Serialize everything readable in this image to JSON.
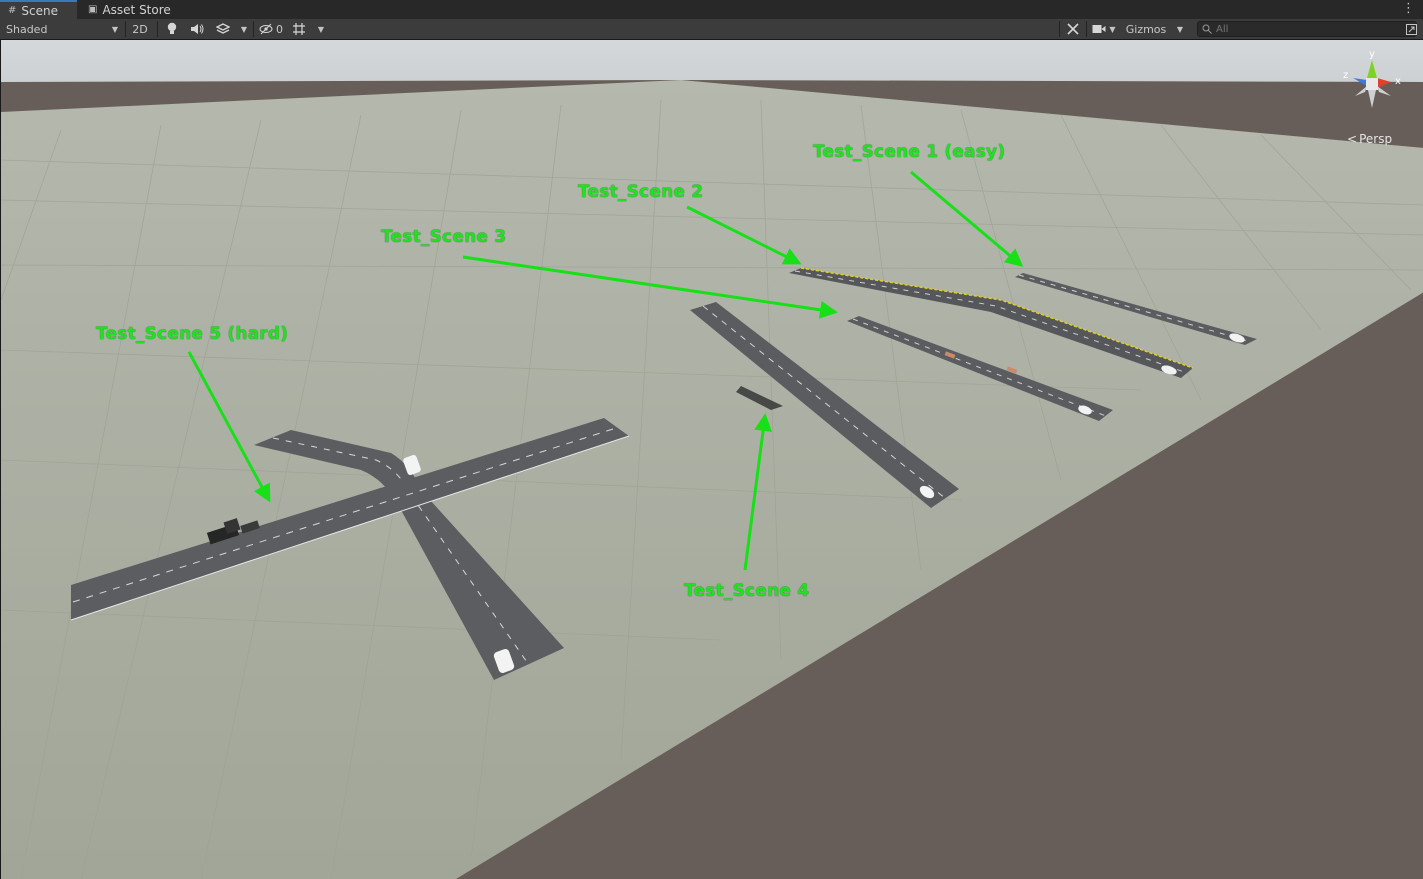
{
  "tabs": [
    {
      "label": "Scene",
      "icon": "grid-icon",
      "active": true
    },
    {
      "label": "Asset Store",
      "icon": "store-bag-icon",
      "active": false
    }
  ],
  "toolbar": {
    "draw_mode": "Shaded",
    "mode_2d": "2D",
    "hidden_count": "0",
    "gizmos_label": "Gizmos",
    "search_placeholder": "All"
  },
  "scene": {
    "camera_label": "Persp",
    "axis_labels": {
      "x": "x",
      "y": "y",
      "z": "z"
    },
    "annotations": [
      {
        "id": "scene1",
        "text": "Test_Scene 1 (easy)"
      },
      {
        "id": "scene2",
        "text": "Test_Scene 2"
      },
      {
        "id": "scene3",
        "text": "Test_Scene 3"
      },
      {
        "id": "scene4",
        "text": "Test_Scene 4"
      },
      {
        "id": "scene5",
        "text": "Test_Scene 5 (hard)"
      }
    ],
    "colors": {
      "sky": "#c9cdcf",
      "ground_plane": "#a7ab9f",
      "void": "#675e59",
      "road": "#5a5c60",
      "annotation": "#22e022",
      "axis_x": "#e0412c",
      "axis_y": "#7ed321",
      "axis_z": "#3b7be0"
    }
  }
}
